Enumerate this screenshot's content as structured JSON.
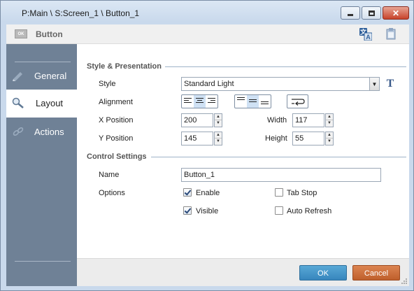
{
  "window": {
    "title": "P:Main \\ S:Screen_1 \\ Button_1"
  },
  "header": {
    "icon_text": "OK",
    "title": "Button",
    "translate_icon": "translate-icon",
    "clipboard_icon": "clipboard-icon"
  },
  "sidebar": {
    "items": [
      {
        "label": "General",
        "icon": "pencil-icon",
        "active": false
      },
      {
        "label": "Layout",
        "icon": "magnifier-icon",
        "active": true
      },
      {
        "label": "Actions",
        "icon": "link-icon",
        "active": false
      }
    ]
  },
  "style_section": {
    "title": "Style & Presentation",
    "style_label": "Style",
    "style_value": "Standard Light",
    "text_style_button": "T",
    "alignment_label": "Alignment",
    "horizontal_alignment_selected": "center",
    "vertical_alignment_selected": "middle",
    "word_wrap_icon": "word-wrap-icon",
    "x_label": "X Position",
    "x_value": "200",
    "y_label": "Y Position",
    "y_value": "145",
    "width_label": "Width",
    "width_value": "117",
    "height_label": "Height",
    "height_value": "55"
  },
  "control_section": {
    "title": "Control Settings",
    "name_label": "Name",
    "name_value": "Button_1",
    "options_label": "Options",
    "options": [
      {
        "label": "Enable",
        "checked": true
      },
      {
        "label": "Tab Stop",
        "checked": false
      },
      {
        "label": "Visible",
        "checked": true
      },
      {
        "label": "Auto Refresh",
        "checked": false
      }
    ]
  },
  "footer": {
    "ok_label": "OK",
    "cancel_label": "Cancel"
  },
  "colors": {
    "sidebar_bg": "#6f8196",
    "ok_button": "#3f93c9",
    "cancel_button": "#cf6f3c",
    "section_line": "#9fb3c8"
  }
}
